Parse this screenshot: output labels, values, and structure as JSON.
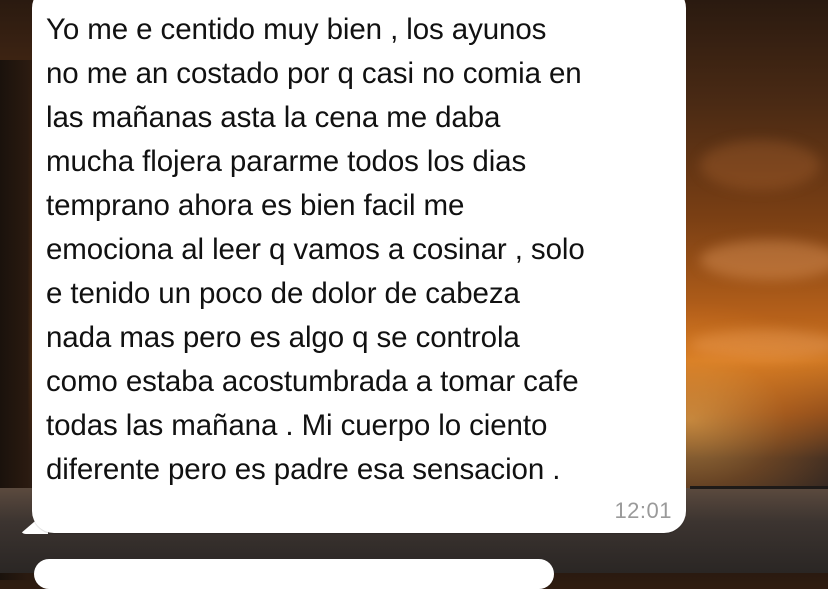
{
  "chat": {
    "message": {
      "text": "Yo me e centido muy bien , los ayunos\nno me an costado por q casi no comia en\nlas mañanas asta la cena me daba\nmucha flojera pararme todos los dias\ntemprano ahora es bien facil me\nemociona al leer q vamos a cosinar , solo\ne tenido un poco de dolor de cabeza\nnada mas pero es algo q se controla\ncomo estaba acostumbrada a tomar cafe\ntodas las mañana . Mi cuerpo lo ciento\ndiferente pero es padre esa sensacion .",
      "time": "12:01"
    },
    "next_message": {
      "sender": "",
      "preview": ""
    }
  },
  "colors": {
    "bubble": "#ffffff",
    "text": "#111111",
    "timestamp": "#9a9a9a",
    "sender_green": "#2e8b3a"
  }
}
